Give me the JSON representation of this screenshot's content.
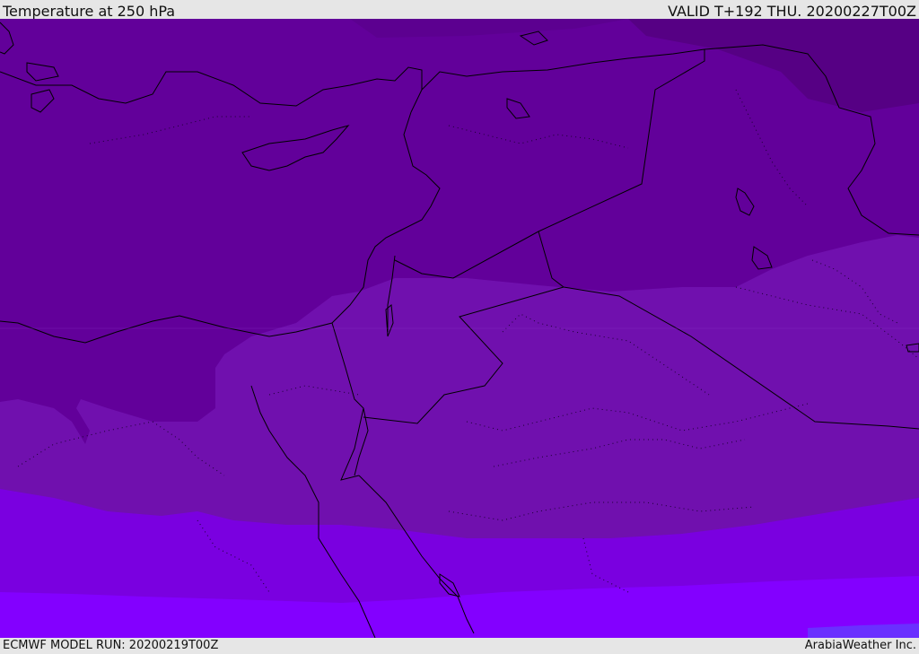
{
  "header": {
    "title": "Temperature at 250 hPa",
    "valid_time": "VALID T+192 THU. 20200227T00Z"
  },
  "footer": {
    "model_run": "ECMWF MODEL RUN: 20200219T00Z",
    "credit": "ArabiaWeather Inc."
  },
  "colors": {
    "band_darkest": "#560084",
    "band_dark": "#62009a",
    "band_mid": "#7010ae",
    "band_light": "#7a00e0",
    "band_lightest": "#8300ff",
    "coastline": "#000000",
    "frame": "#e6e6e6"
  }
}
